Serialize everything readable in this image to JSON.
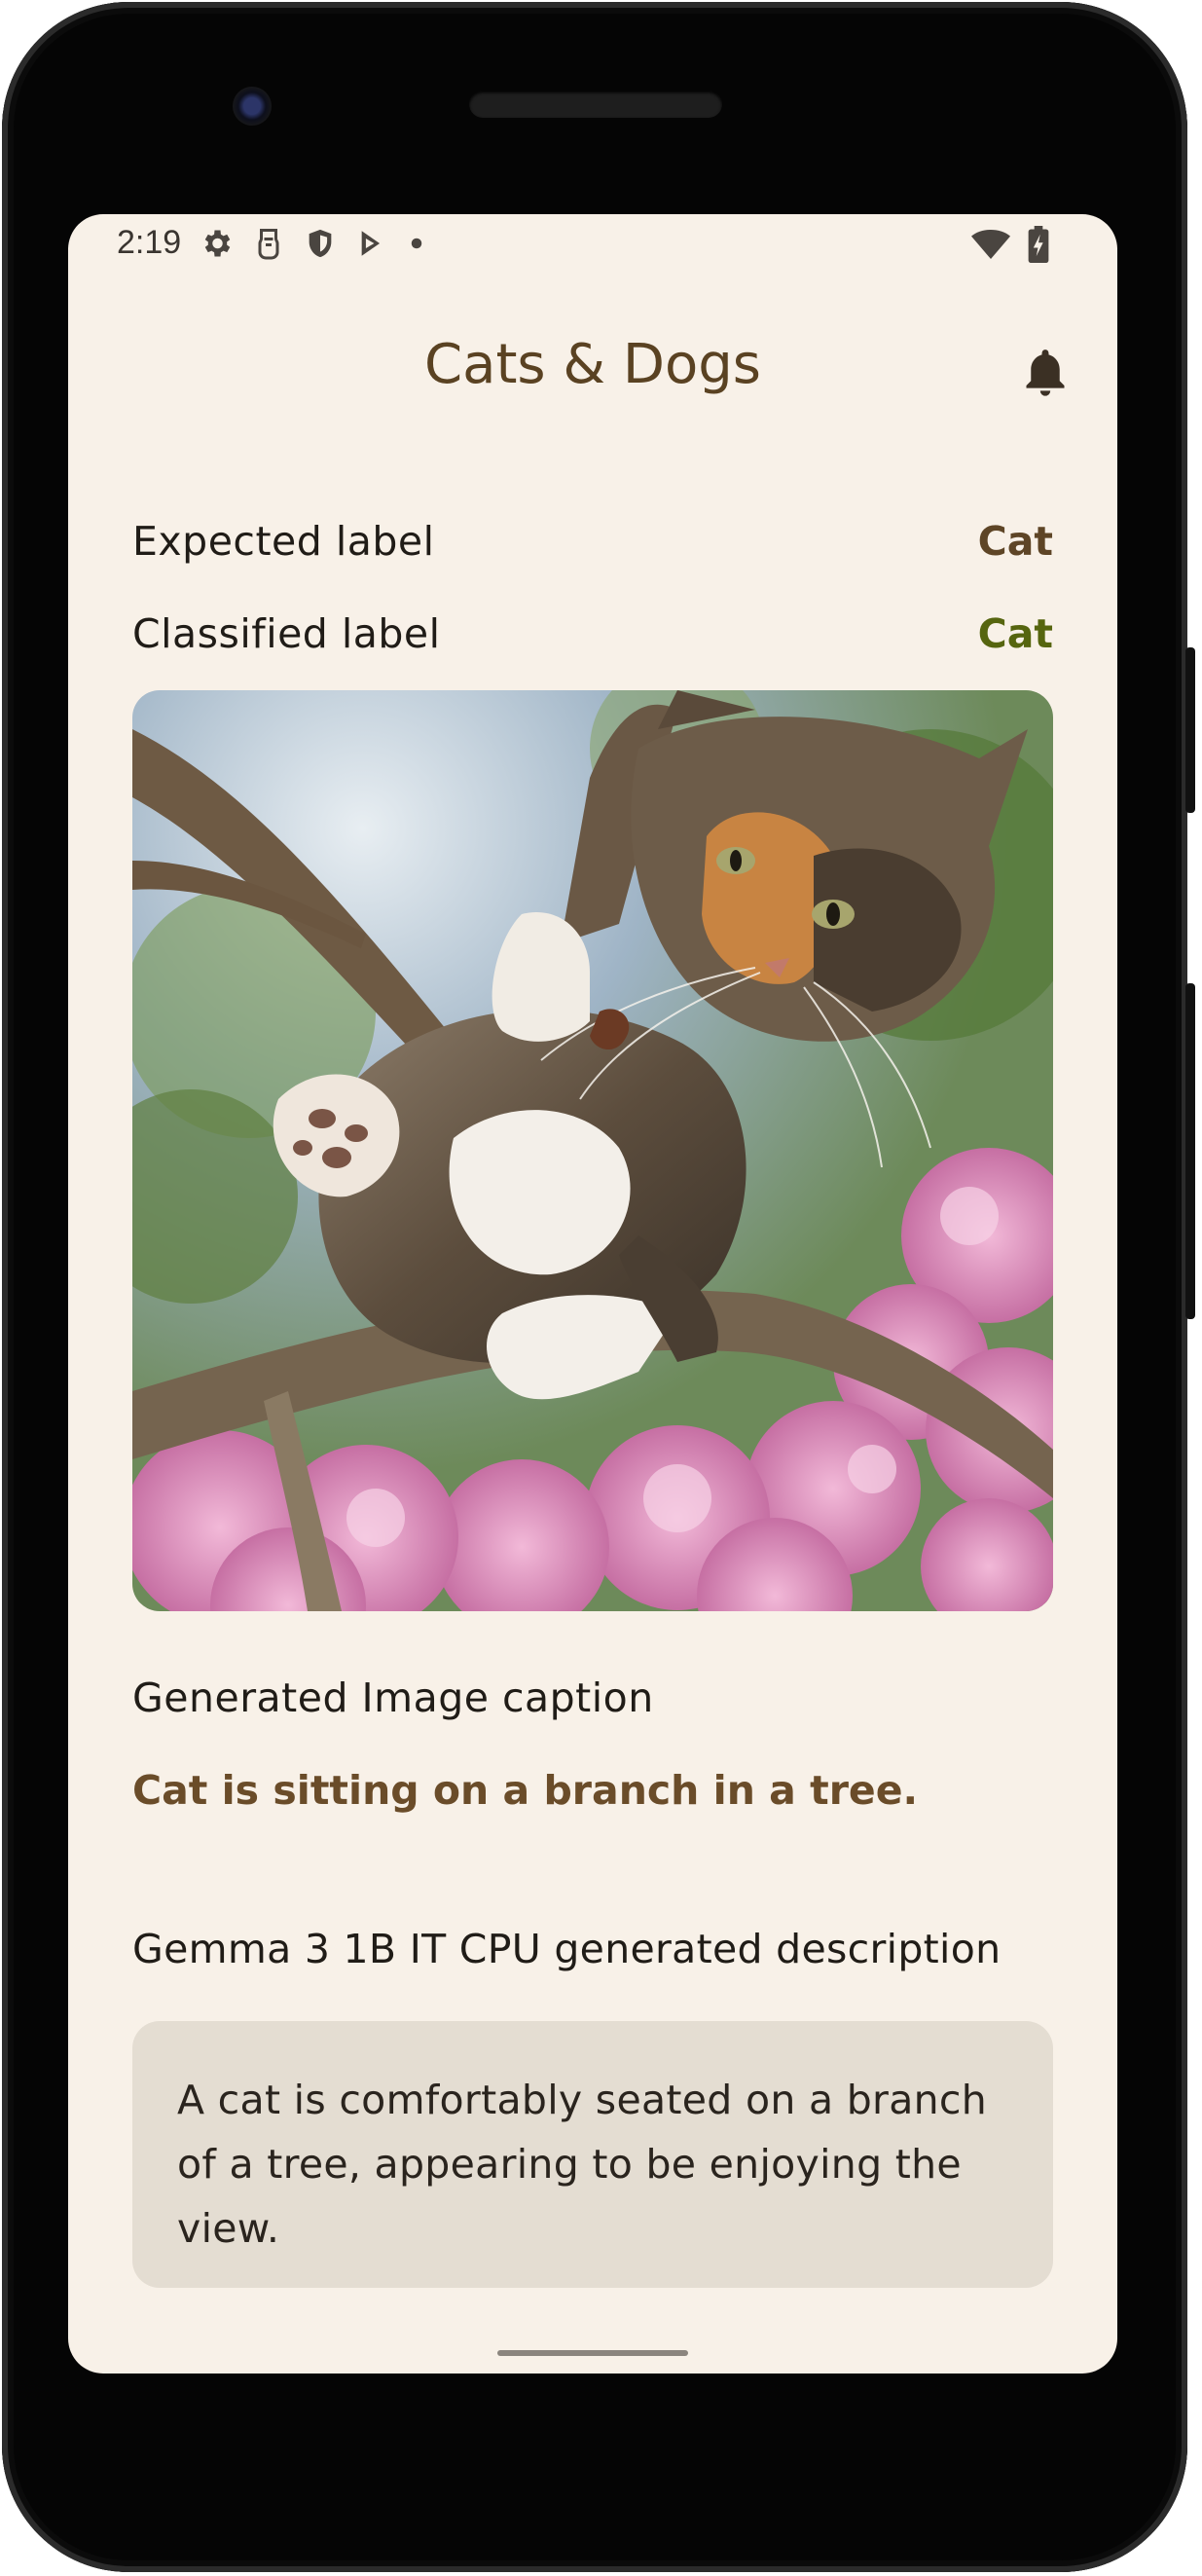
{
  "status_bar": {
    "time": "2:19",
    "left_icons": [
      "settings-icon",
      "sim-card-icon",
      "shield-icon",
      "play-store-icon",
      "notification-dot-icon"
    ],
    "right_icons": [
      "wifi-icon",
      "battery-charging-icon"
    ]
  },
  "app_bar": {
    "title": "Cats & Dogs",
    "action_icon": "bell-icon"
  },
  "labels": {
    "expected_key": "Expected label",
    "expected_value": "Cat",
    "classified_key": "Classified label",
    "classified_value": "Cat"
  },
  "image": {
    "subject": "cat-photo"
  },
  "caption": {
    "heading": "Generated Image caption",
    "text": "Cat is sitting on a branch in a tree."
  },
  "description": {
    "heading": "Gemma 3 1B IT CPU generated description",
    "text": "A cat is comfortably seated on a branch of a tree, appearing to be enjoying the view."
  },
  "colors": {
    "background": "#f8f1e8",
    "title": "#5a4222",
    "expected_value": "#5e4526",
    "classified_value": "#56650f",
    "caption": "#6a4c29",
    "card": "#e4ddd2"
  }
}
